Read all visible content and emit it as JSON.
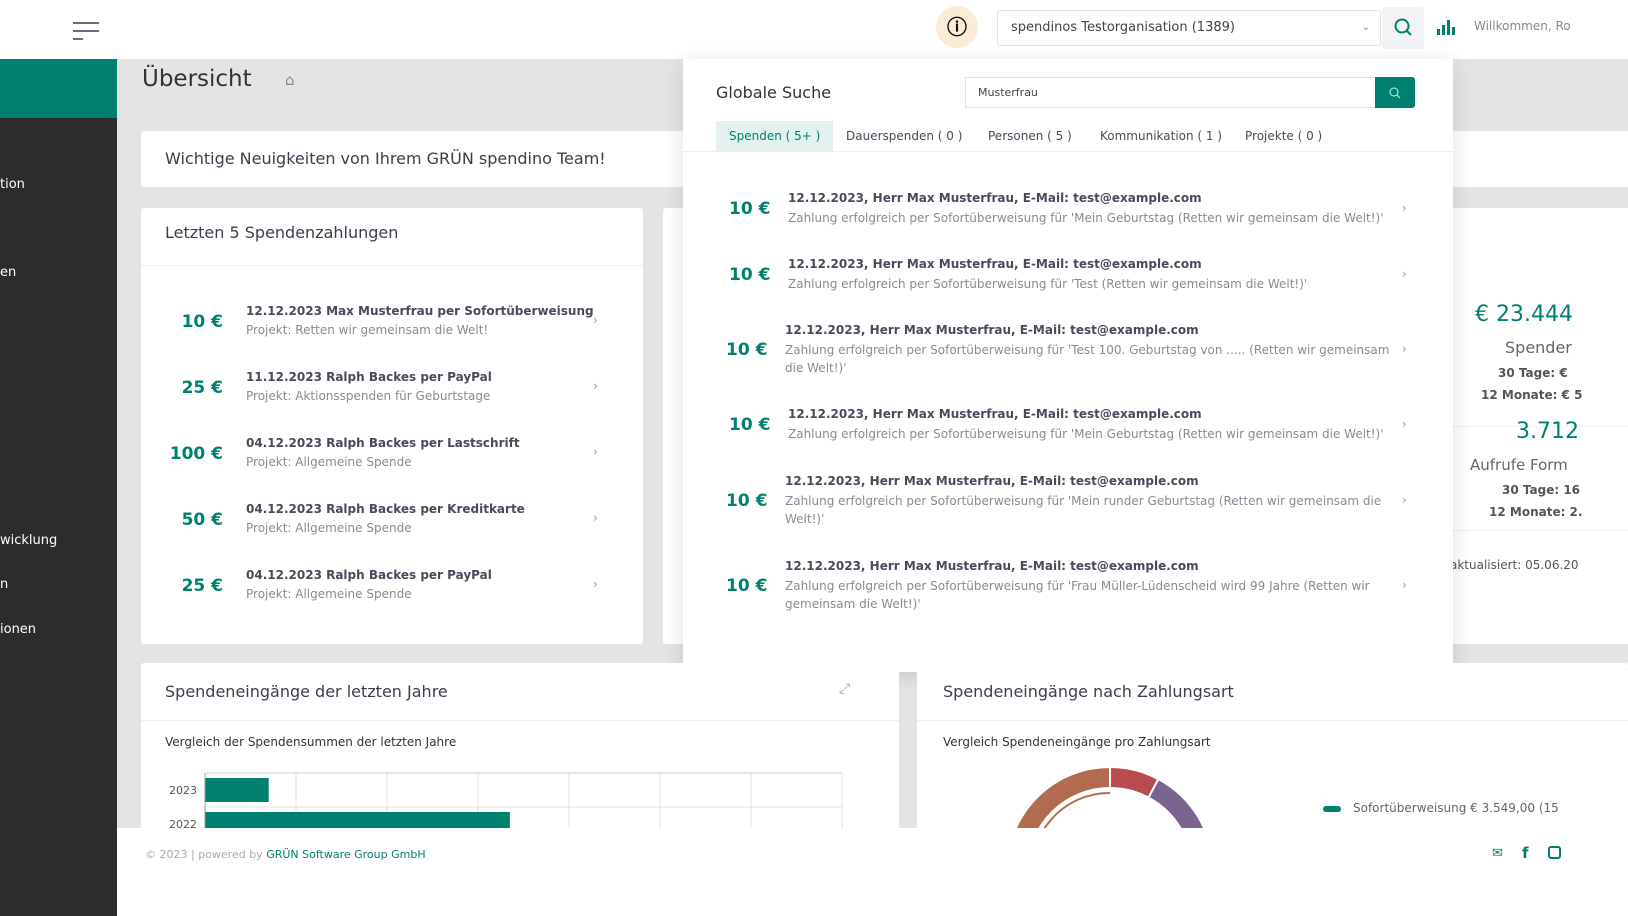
{
  "header": {
    "org_select": "spendinos Testorganisation (1389)",
    "welcome": "Willkommen, Ro"
  },
  "sidebar": {
    "items": [
      {
        "label": "tion"
      },
      {
        "label": "en"
      },
      {
        "label": "wicklung"
      },
      {
        "label": "n"
      },
      {
        "label": "ionen"
      }
    ]
  },
  "page": {
    "title": "Übersicht"
  },
  "news": {
    "title": "Wichtige Neuigkeiten von Ihrem GRÜN spendino Team!"
  },
  "last_payments": {
    "title": "Letzten 5 Spendenzahlungen",
    "items": [
      {
        "amount": "10 €",
        "line1": "12.12.2023 Max Musterfrau per Sofortüberweisung",
        "line2": "Projekt: Retten wir gemeinsam die Welt!"
      },
      {
        "amount": "25 €",
        "line1": "11.12.2023 Ralph Backes per PayPal",
        "line2": "Projekt: Aktionsspenden für Geburtstage"
      },
      {
        "amount": "100 €",
        "line1": "04.12.2023 Ralph Backes per Lastschrift",
        "line2": "Projekt: Allgemeine Spende"
      },
      {
        "amount": "50 €",
        "line1": "04.12.2023 Ralph Backes per Kreditkarte",
        "line2": "Projekt: Allgemeine Spende"
      },
      {
        "amount": "25 €",
        "line1": "04.12.2023 Ralph Backes per PayPal",
        "line2": "Projekt: Allgemeine Spende"
      }
    ]
  },
  "stats": {
    "total": "€ 23.444",
    "total_label": "Spender",
    "total_30": "30 Tage: €",
    "total_12": "12 Monate: € 5",
    "views": "3.712",
    "views_label": "Aufrufe Form",
    "views_30": "30 Tage: 16",
    "views_12": "12 Monate: 2.",
    "updated": "aktualisiert: 05.06.20"
  },
  "search": {
    "title": "Globale Suche",
    "query": "Musterfrau",
    "tabs": [
      {
        "label": "Spenden ( 5+ )"
      },
      {
        "label": "Dauerspenden ( 0 )"
      },
      {
        "label": "Personen ( 5 )"
      },
      {
        "label": "Kommunikation ( 1 )"
      },
      {
        "label": "Projekte ( 0 )"
      }
    ],
    "results": [
      {
        "amount": "10 €",
        "line1": "12.12.2023, Herr Max Musterfrau, E-Mail: test@example.com",
        "line2": "Zahlung erfolgreich per Sofortüberweisung für 'Mein Geburtstag (Retten wir gemeinsam die Welt!)'"
      },
      {
        "amount": "10 €",
        "line1": "12.12.2023, Herr Max Musterfrau, E-Mail: test@example.com",
        "line2": "Zahlung erfolgreich per Sofortüberweisung für 'Test (Retten wir gemeinsam die Welt!)'"
      },
      {
        "amount": "10 €",
        "line1": "12.12.2023, Herr Max Musterfrau, E-Mail: test@example.com",
        "line2": "Zahlung erfolgreich per Sofortüberweisung für 'Test 100. Geburtstag von ..... (Retten wir gemeinsam die Welt!)'"
      },
      {
        "amount": "10 €",
        "line1": "12.12.2023, Herr Max Musterfrau, E-Mail: test@example.com",
        "line2": "Zahlung erfolgreich per Sofortüberweisung für 'Mein Geburtstag (Retten wir gemeinsam die Welt!)'"
      },
      {
        "amount": "10 €",
        "line1": "12.12.2023, Herr Max Musterfrau, E-Mail: test@example.com",
        "line2": "Zahlung erfolgreich per Sofortüberweisung für 'Mein runder Geburtstag (Retten wir gemeinsam die Welt!)'"
      },
      {
        "amount": "10 €",
        "line1": "12.12.2023, Herr Max Musterfrau, E-Mail: test@example.com",
        "line2": "Zahlung erfolgreich per Sofortüberweisung für 'Frau Müller-Lüdenscheid wird 99 Jahre (Retten wir gemeinsam die Welt!)'"
      }
    ]
  },
  "years_card": {
    "title": "Spendeneingänge der letzten Jahre"
  },
  "pay_card": {
    "title": "Spendeneingänge nach Zahlungsart"
  },
  "chart_data": [
    {
      "type": "bar",
      "orientation": "horizontal",
      "title": "Vergleich der Spendensummen der letzten Jahre",
      "categories": [
        "2023",
        "2022"
      ],
      "values": [
        0.7,
        3.35
      ],
      "xlim": [
        0,
        7
      ],
      "grid": true,
      "bar_color": "#00806f"
    },
    {
      "type": "pie",
      "variant": "donut",
      "title": "Vergleich Spendeneingänge pro Zahlungsart",
      "legend": [
        {
          "label": "Sofortüberweisung € 3.549,00 (15",
          "color": "#00806f"
        }
      ],
      "segment_colors": [
        "#b36b50",
        "#b84b4f",
        "#7a6590"
      ],
      "legend_placement": "right"
    }
  ],
  "footer": {
    "copyright": "© 2023 | powered by ",
    "company": "GRÜN Software Group GmbH"
  },
  "colors": {
    "accent": "#00806f",
    "sidebar": "#2c2c2c"
  }
}
